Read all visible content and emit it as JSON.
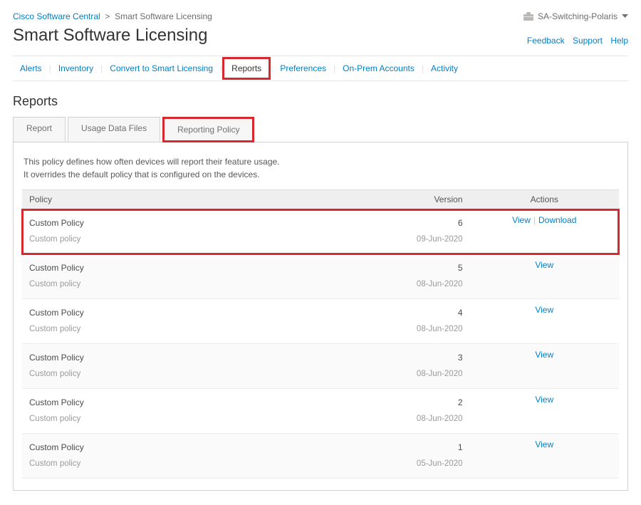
{
  "breadcrumb": {
    "root": "Cisco Software Central",
    "sep": ">",
    "current": "Smart Software Licensing"
  },
  "account": {
    "name": "SA-Switching-Polaris"
  },
  "page_title": "Smart Software Licensing",
  "help_links": {
    "feedback": "Feedback",
    "support": "Support",
    "help": "Help"
  },
  "nav": [
    {
      "label": "Alerts"
    },
    {
      "label": "Inventory"
    },
    {
      "label": "Convert to Smart Licensing"
    },
    {
      "label": "Reports",
      "active": true,
      "highlight": true
    },
    {
      "label": "Preferences"
    },
    {
      "label": "On-Prem Accounts"
    },
    {
      "label": "Activity"
    }
  ],
  "section_title": "Reports",
  "subtabs": [
    {
      "label": "Report"
    },
    {
      "label": "Usage Data Files"
    },
    {
      "label": "Reporting Policy",
      "active": true,
      "highlight": true
    }
  ],
  "description": {
    "line1": "This policy defines how often devices will report their feature usage.",
    "line2": "It overrides the default policy that is configured on the devices."
  },
  "table": {
    "headers": {
      "policy": "Policy",
      "version": "Version",
      "actions": "Actions"
    },
    "rows": [
      {
        "name": "Custom Policy",
        "sub": "Custom policy",
        "version": "6",
        "date": "09-Jun-2020",
        "actions": [
          "View",
          "Download"
        ],
        "highlight": true,
        "alt": false
      },
      {
        "name": "Custom Policy",
        "sub": "Custom policy",
        "version": "5",
        "date": "08-Jun-2020",
        "actions": [
          "View"
        ],
        "alt": true
      },
      {
        "name": "Custom Policy",
        "sub": "Custom policy",
        "version": "4",
        "date": "08-Jun-2020",
        "actions": [
          "View"
        ],
        "alt": false
      },
      {
        "name": "Custom Policy",
        "sub": "Custom policy",
        "version": "3",
        "date": "08-Jun-2020",
        "actions": [
          "View"
        ],
        "alt": true
      },
      {
        "name": "Custom Policy",
        "sub": "Custom policy",
        "version": "2",
        "date": "08-Jun-2020",
        "actions": [
          "View"
        ],
        "alt": false
      },
      {
        "name": "Custom Policy",
        "sub": "Custom policy",
        "version": "1",
        "date": "05-Jun-2020",
        "actions": [
          "View"
        ],
        "alt": true
      }
    ]
  }
}
